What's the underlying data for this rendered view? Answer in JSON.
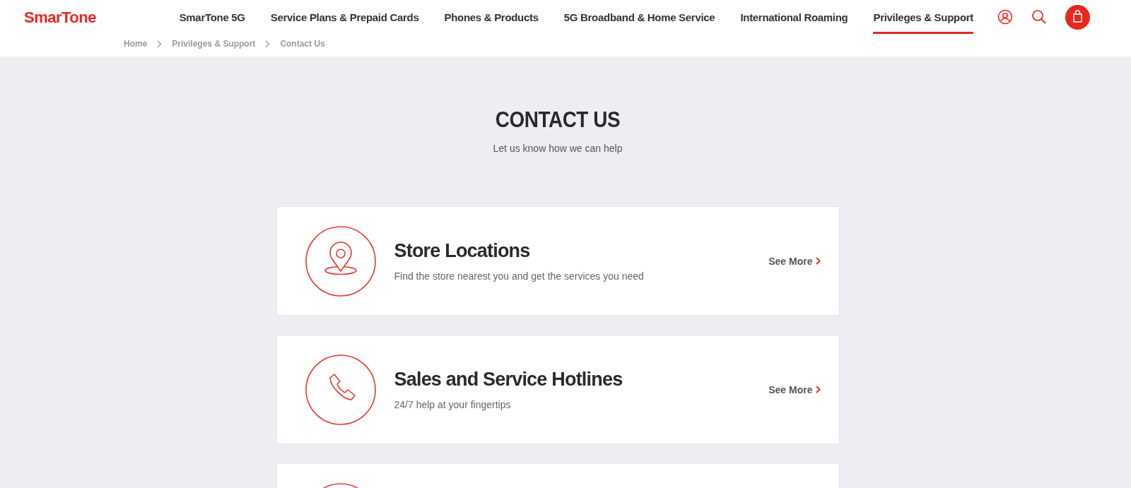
{
  "header": {
    "logo": "SmarTone",
    "nav": [
      {
        "label": "SmarTone 5G",
        "selected": false
      },
      {
        "label": "Service Plans & Prepaid Cards",
        "selected": false
      },
      {
        "label": "Phones & Products",
        "selected": false
      },
      {
        "label": "5G Broadband & Home Service",
        "selected": false
      },
      {
        "label": "International Roaming",
        "selected": false
      },
      {
        "label": "Privileges & Support",
        "selected": true
      }
    ]
  },
  "breadcrumb": [
    "Home",
    "Privileges & Support",
    "Contact Us"
  ],
  "heading": {
    "title": "CONTACT US",
    "subtitle": "Let us know how we can help"
  },
  "cards": [
    {
      "kind": "full",
      "title": "Store Locations",
      "description": "Find the store nearest you and get the services you need",
      "link": "See More"
    },
    {
      "kind": "full",
      "title": "Sales and Service Hotlines",
      "description": "24/7 help at your fingertips",
      "link": "See More"
    },
    {
      "kind": "partial"
    }
  ]
}
